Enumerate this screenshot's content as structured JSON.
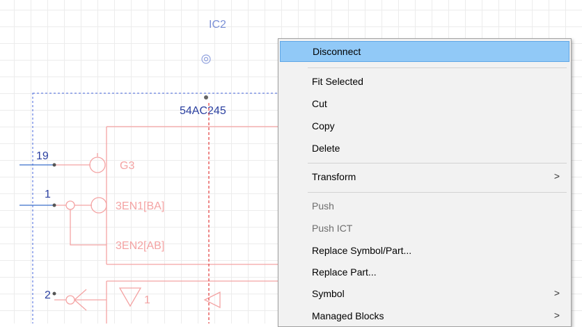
{
  "schematic": {
    "ref_designator": "IC2",
    "part_name": "54AC245",
    "pins": [
      {
        "number": "19",
        "label": "G3"
      },
      {
        "number": "1",
        "label": "3EN1[BA]"
      },
      {
        "number": "",
        "label": "3EN2[AB]"
      },
      {
        "number": "2",
        "label": "1"
      }
    ]
  },
  "context_menu": {
    "items": [
      {
        "label": "Disconnect",
        "state": "highlighted"
      },
      {
        "label": "Fit Selected",
        "state": "normal"
      },
      {
        "label": "Cut",
        "state": "normal"
      },
      {
        "label": "Copy",
        "state": "normal"
      },
      {
        "label": "Delete",
        "state": "normal"
      },
      {
        "label": "Transform",
        "state": "normal",
        "submenu": true
      },
      {
        "label": "Push",
        "state": "disabled"
      },
      {
        "label": "Push ICT",
        "state": "disabled"
      },
      {
        "label": "Replace Symbol/Part...",
        "state": "normal"
      },
      {
        "label": "Replace Part...",
        "state": "normal"
      },
      {
        "label": "Symbol",
        "state": "normal",
        "submenu": true
      },
      {
        "label": "Managed Blocks",
        "state": "normal",
        "submenu": true
      }
    ],
    "submenu_arrow": ">"
  },
  "colors": {
    "symbol": "#f4a3a3",
    "pin": "#3b6fc9",
    "selection": "#4466dd",
    "highlight": "#91c9f7"
  }
}
